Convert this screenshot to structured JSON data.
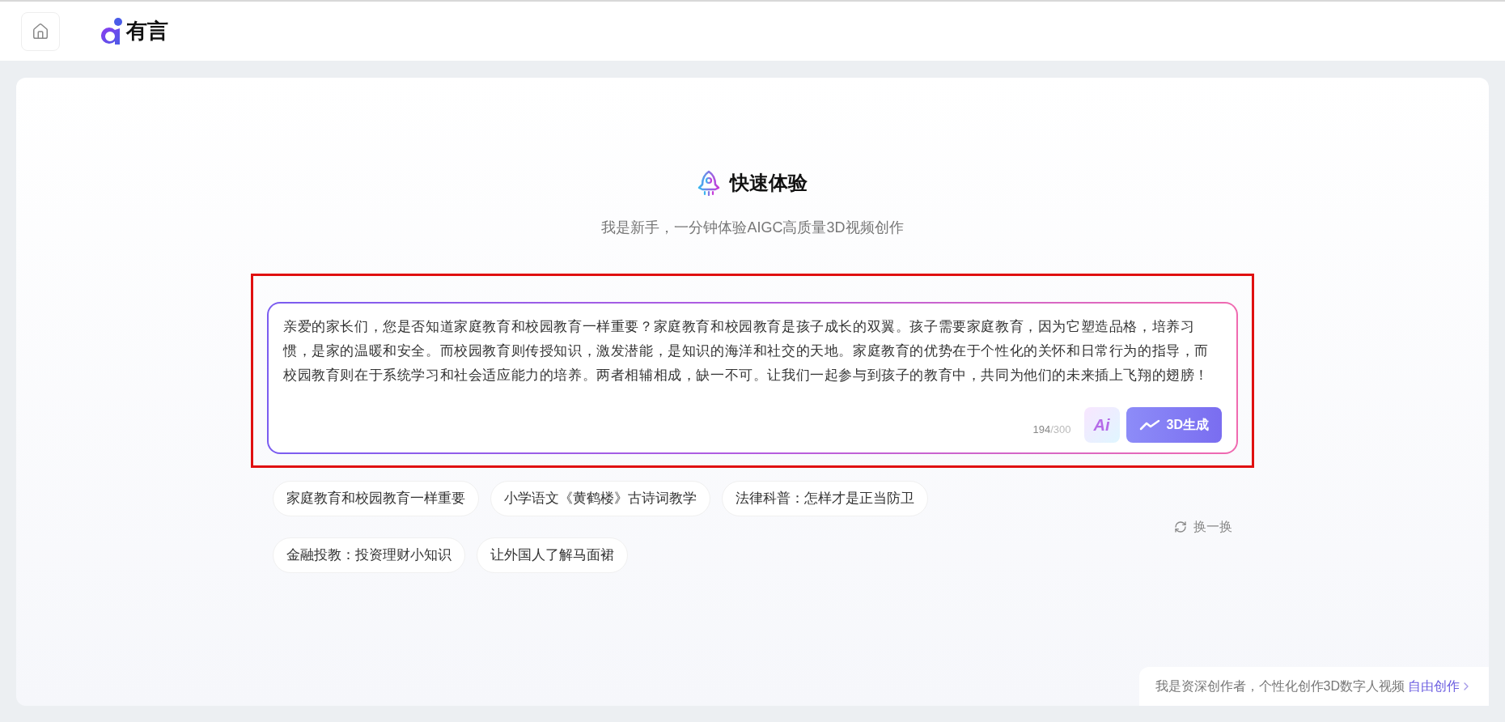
{
  "header": {
    "logo_text": "有言"
  },
  "hero": {
    "title": "快速体验",
    "subtitle": "我是新手，一分钟体验AIGC高质量3D视频创作"
  },
  "editor": {
    "value": "亲爱的家长们，您是否知道家庭教育和校园教育一样重要？家庭教育和校园教育是孩子成长的双翼。孩子需要家庭教育，因为它塑造品格，培养习惯，是家的温暖和安全。而校园教育则传授知识，激发潜能，是知识的海洋和社交的天地。家庭教育的优势在于个性化的关怀和日常行为的指导，而校园教育则在于系统学习和社会适应能力的培养。两者相辅相成，缺一不可。让我们一起参与到孩子的教育中，共同为他们的未来插上飞翔的翅膀！",
    "count": "194",
    "max": "/300",
    "ai_label": "Ai",
    "generate_label": "3D生成"
  },
  "topics": [
    {
      "label": "家庭教育和校园教育一样重要"
    },
    {
      "label": "小学语文《黄鹤楼》古诗词教学"
    },
    {
      "label": "法律科普：怎样才是正当防卫"
    },
    {
      "label": "金融投教：投资理财小知识"
    },
    {
      "label": "让外国人了解马面裙"
    }
  ],
  "refresh_label": "换一换",
  "footer": {
    "text": "我是资深创作者，个性化创作3D数字人视频",
    "link": "自由创作"
  }
}
